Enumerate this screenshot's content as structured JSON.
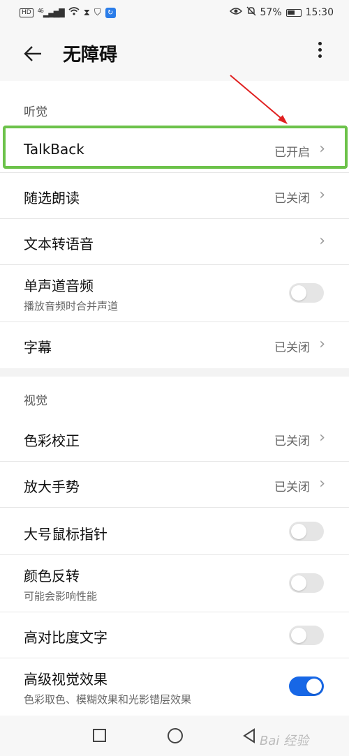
{
  "status_bar": {
    "network": "HD",
    "signal": "46",
    "battery": "57%",
    "time": "15:30"
  },
  "header": {
    "title": "无障碍",
    "back_icon": "arrow-left-icon",
    "more_icon": "more-vertical-icon"
  },
  "hearing": {
    "label": "听觉",
    "talkback": {
      "title": "TalkBack",
      "status": "已开启"
    },
    "select_to_speak": {
      "title": "随选朗读",
      "status": "已关闭"
    },
    "tts": {
      "title": "文本转语音"
    },
    "mono_audio": {
      "title": "单声道音频",
      "subtitle": "播放音频时合并声道",
      "enabled": false
    },
    "captions": {
      "title": "字幕",
      "status": "已关闭"
    }
  },
  "vision": {
    "label": "视觉",
    "color_correction": {
      "title": "色彩校正",
      "status": "已关闭"
    },
    "magnification": {
      "title": "放大手势",
      "status": "已关闭"
    },
    "large_pointer": {
      "title": "大号鼠标指针",
      "enabled": false
    },
    "color_inversion": {
      "title": "颜色反转",
      "subtitle": "可能会影响性能",
      "enabled": false
    },
    "high_contrast": {
      "title": "高对比度文字",
      "enabled": false
    },
    "advanced_visual": {
      "title": "高级视觉效果",
      "subtitle": "色彩取色、模糊效果和光影错层效果",
      "enabled": true
    }
  },
  "colors": {
    "accent": "#1767e6",
    "highlight": "#6cc24a",
    "arrow": "#e02020"
  },
  "watermark": "Bai 经验"
}
